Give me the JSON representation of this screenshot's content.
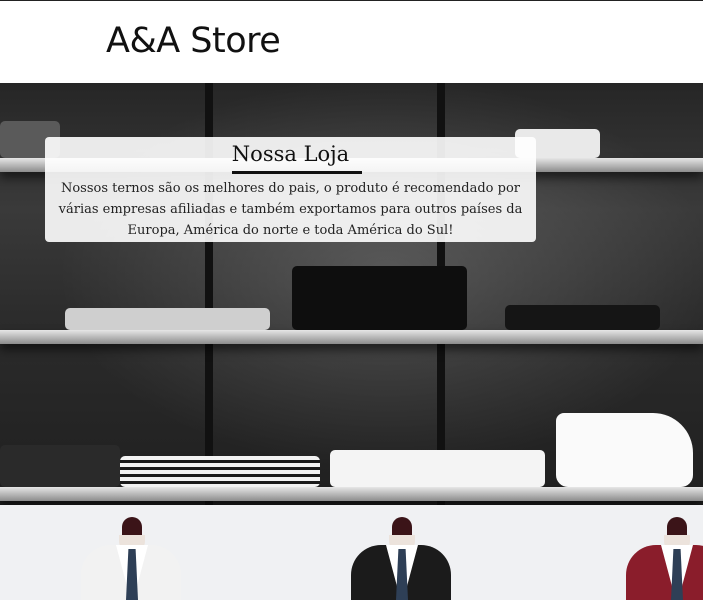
{
  "header": {
    "brand": "A&A Store"
  },
  "hero": {
    "title": "Nossa Loja",
    "description": "Nossos ternos são os melhores do pais, o produto é recomendado por várias empresas afiliadas e também exportamos para outros países da Europa, América do norte e toda América do Sul!"
  },
  "products": {
    "items": [
      {
        "name": "white-suit",
        "jacket_color": "#f2f2f2"
      },
      {
        "name": "black-suit",
        "jacket_color": "#1b1b1b"
      },
      {
        "name": "burgundy-suit",
        "jacket_color": "#8a1d2b"
      }
    ]
  },
  "colors": {
    "page_bg": "#ffffff",
    "products_bg": "#f0f1f3",
    "text": "#111111"
  }
}
